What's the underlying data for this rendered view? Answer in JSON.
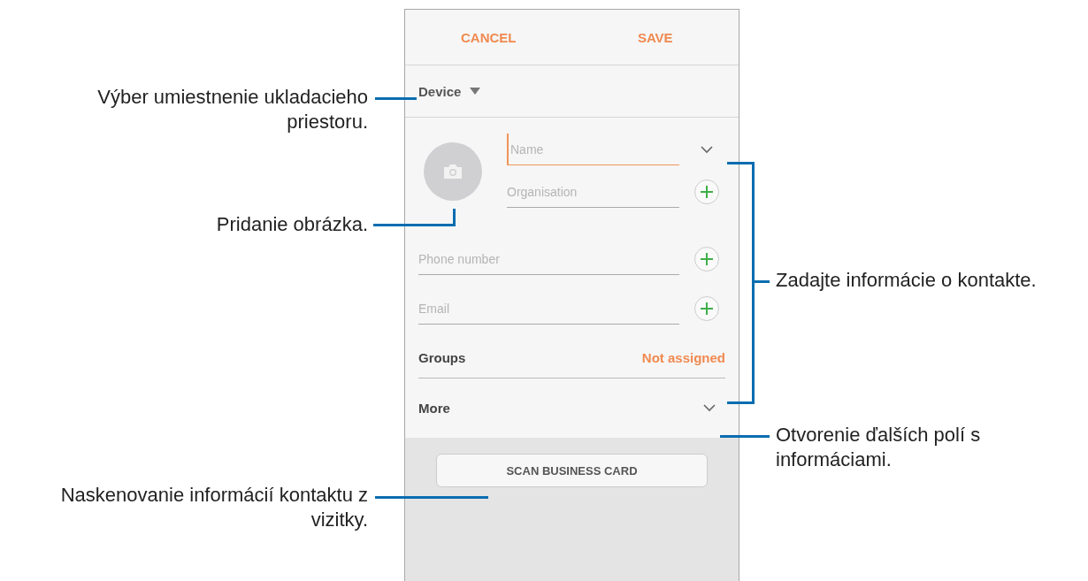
{
  "header": {
    "buttons": [
      "CANCEL",
      "SAVE"
    ]
  },
  "storage": {
    "label": "Device"
  },
  "photo_fields": [
    {
      "placeholder": "Name",
      "focused": true,
      "kind": "expand"
    },
    {
      "placeholder": "Organisation",
      "focused": false,
      "kind": "add"
    }
  ],
  "fields": [
    {
      "placeholder": "Phone number",
      "focused": false,
      "kind": "add"
    },
    {
      "placeholder": "Email",
      "focused": false,
      "kind": "add"
    }
  ],
  "groups": {
    "label": "Groups",
    "value": "Not assigned"
  },
  "more": {
    "label": "More"
  },
  "scan_button": {
    "label": "SCAN BUSINESS CARD"
  },
  "left_callouts": [
    "Výber umiestnenie ukladacieho priestoru.",
    "Pridanie obrázka.",
    "Naskenovanie informácií kontaktu z vizitky."
  ],
  "right_callouts": [
    "Zadajte informácie o kontakte.",
    "Otvorenie ďalších polí s informáciami."
  ]
}
